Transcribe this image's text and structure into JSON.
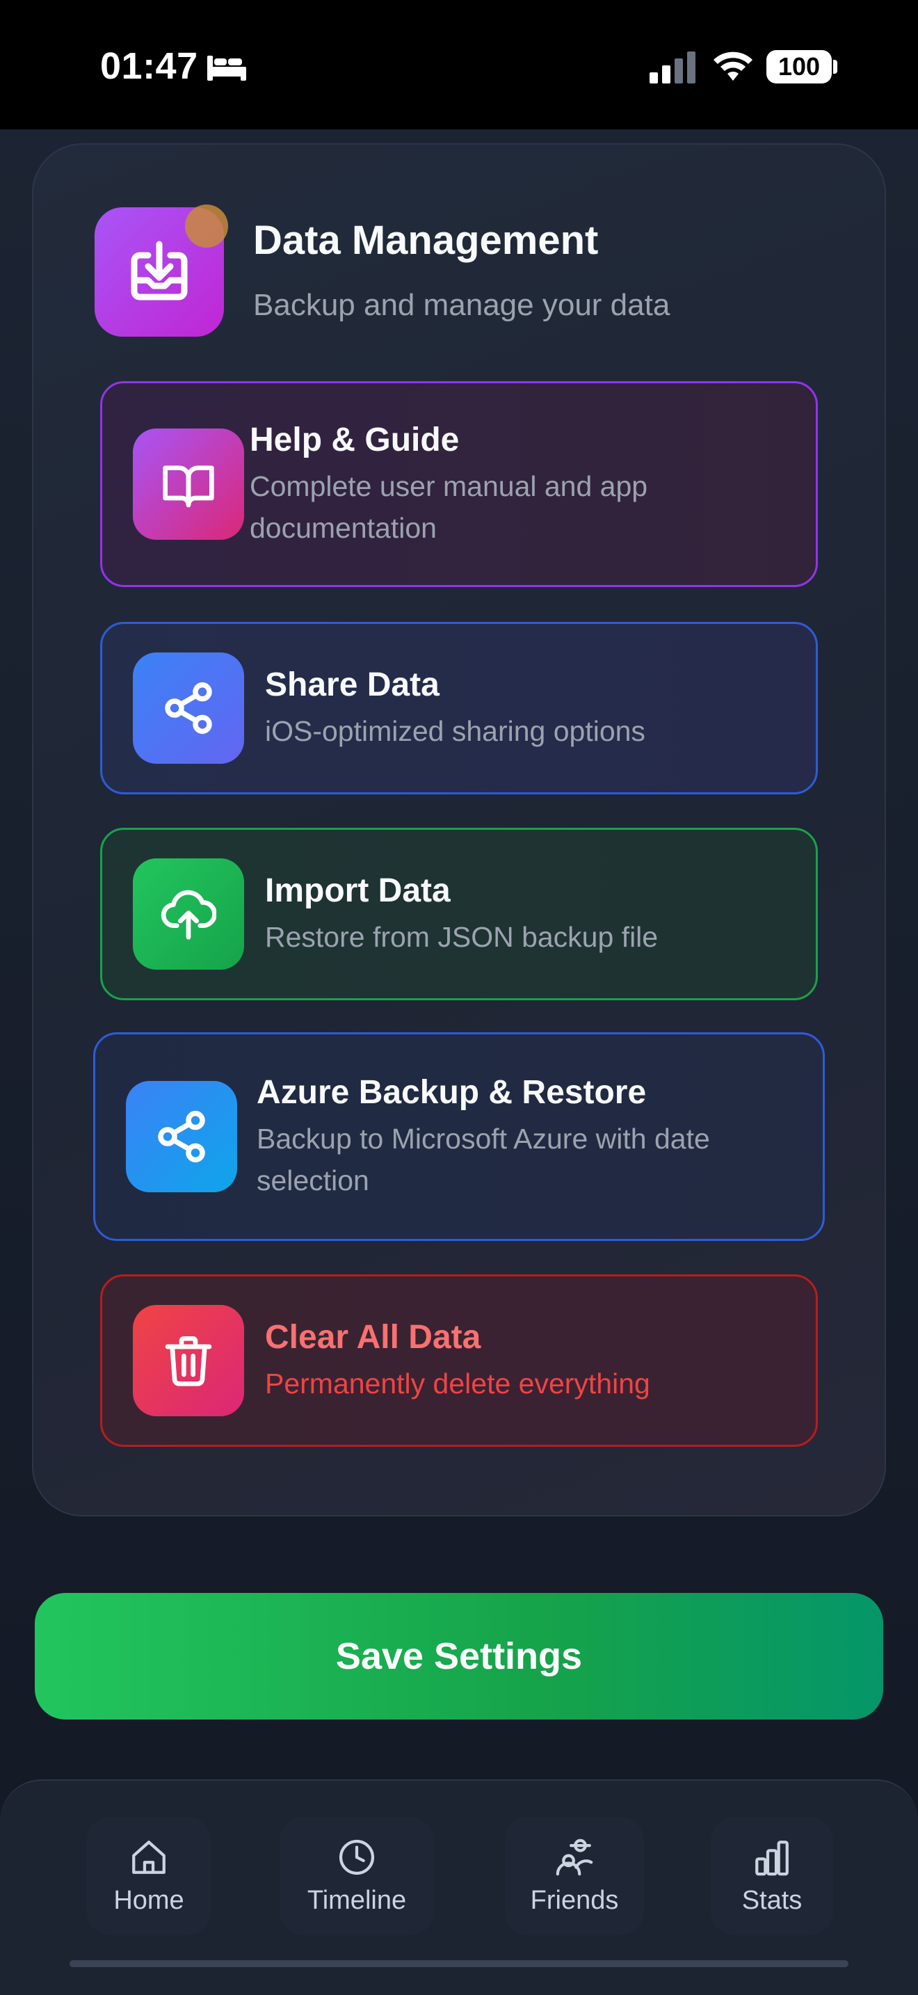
{
  "status_bar": {
    "time": "01:47",
    "battery": "100",
    "icons": [
      "bed-icon",
      "signal-icon",
      "wifi-icon",
      "battery-icon"
    ]
  },
  "section": {
    "title": "Data Management",
    "subtitle": "Backup and manage your data",
    "icon": "download-tray-icon"
  },
  "options": {
    "help": {
      "title": "Help & Guide",
      "desc": "Complete user manual and app documentation",
      "icon": "book-icon"
    },
    "share": {
      "title": "Share Data",
      "desc": "iOS-optimized sharing options",
      "icon": "share-icon"
    },
    "import": {
      "title": "Import Data",
      "desc": "Restore from JSON backup file",
      "icon": "cloud-upload-icon"
    },
    "azure": {
      "title": "Azure Backup & Restore",
      "desc": "Backup to Microsoft Azure with date selection",
      "icon": "share-icon"
    },
    "clear": {
      "title": "Clear All Data",
      "desc": "Permanently delete everything",
      "icon": "trash-icon"
    }
  },
  "save_button": {
    "label": "Save Settings"
  },
  "nav": {
    "home": {
      "label": "Home",
      "icon": "home-icon"
    },
    "timeline": {
      "label": "Timeline",
      "icon": "clock-icon"
    },
    "friends": {
      "label": "Friends",
      "icon": "friends-icon"
    },
    "stats": {
      "label": "Stats",
      "icon": "bar-chart-icon"
    }
  },
  "colors": {
    "background": "#141a26",
    "card": "#222b3b",
    "accent_purple": "#a855f7",
    "accent_blue": "#3b82f6",
    "accent_green": "#22c55e",
    "danger": "#ef4444"
  }
}
